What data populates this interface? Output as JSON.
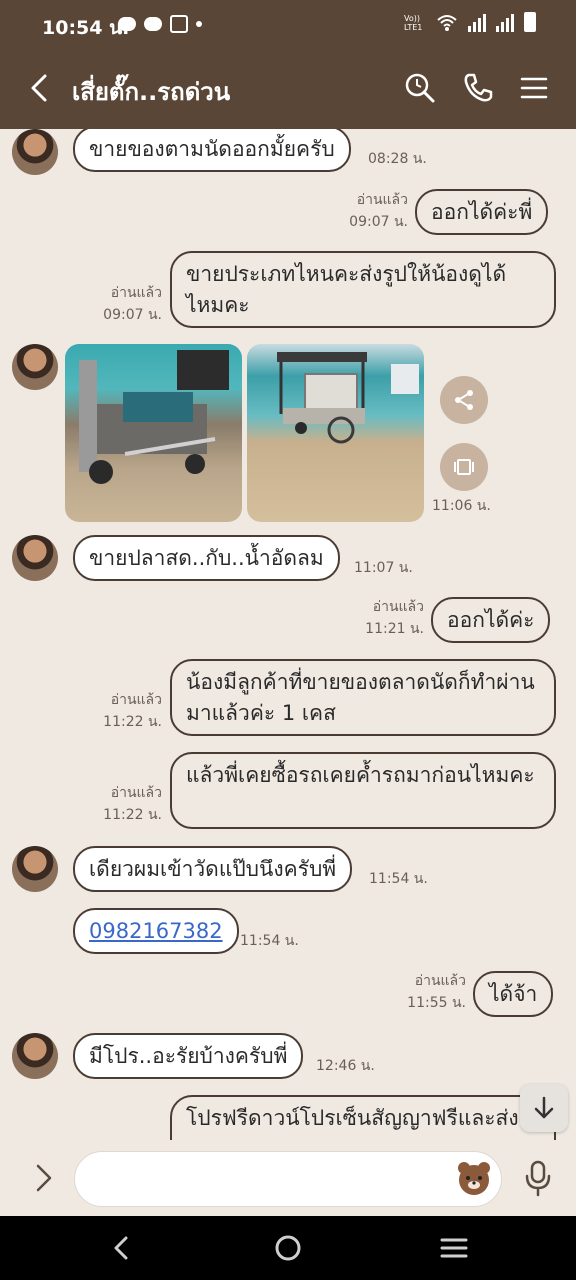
{
  "status_bar": {
    "time": "10:54 น.",
    "icons": [
      "line-icon",
      "line-icon",
      "seven-eleven-icon",
      "dot-icon",
      "volte-icon",
      "wifi-icon",
      "signal-icon",
      "signal-icon",
      "battery-icon"
    ]
  },
  "header": {
    "title": "เสี่ยตั๊ก..รถด่วน",
    "back_icon": "chevron-left-icon",
    "actions": [
      "search-icon",
      "phone-icon",
      "menu-icon"
    ]
  },
  "messages": [
    {
      "side": "them",
      "text": "ขายของตามนัดออกมั้ยครับ",
      "time": "08:28 น."
    },
    {
      "side": "me",
      "text": "ออกได้ค่ะพี่",
      "read": "อ่านแล้ว",
      "time": "09:07 น."
    },
    {
      "side": "me",
      "text": "ขายประเภทไหนคะส่งรูปให้น้องดูได้ไหมคะ",
      "read": "อ่านแล้ว",
      "time": "09:07 น."
    },
    {
      "side": "them",
      "type": "photos",
      "count": 2,
      "time": "11:06 น."
    },
    {
      "side": "them",
      "text": "ขายปลาสด..กับ..น้ำอัดลม",
      "time": "11:07 น."
    },
    {
      "side": "me",
      "text": "ออกได้ค่ะ",
      "read": "อ่านแล้ว",
      "time": "11:21 น."
    },
    {
      "side": "me",
      "text": "น้องมีลูกค้าที่ขายของตลาดนัดก็ทำผ่านมาแล้วค่ะ 1 เคส",
      "read": "อ่านแล้ว",
      "time": "11:22 น."
    },
    {
      "side": "me",
      "text": "แล้วพี่เคยซื้อรถเคยค้ำรถมาก่อนไหมคะ",
      "read": "อ่านแล้ว",
      "time": "11:22 น."
    },
    {
      "side": "them",
      "text": "เดียวผมเข้าวัดแป๊บนึงครับพี่",
      "time": "11:54 น."
    },
    {
      "side": "them",
      "text": "0982167382",
      "link": true,
      "time": "11:54 น."
    },
    {
      "side": "me",
      "text": "ได้จ้า",
      "read": "อ่านแล้ว",
      "time": "11:55 น."
    },
    {
      "side": "them",
      "text": "มีโปร..อะรัยบ้างครับพี่",
      "time": "12:46 น."
    },
    {
      "side": "me",
      "text": "โปรฟรีดาวน์โปรเซ็นสัญญาฟรีและส่ง",
      "partial": true
    }
  ],
  "photo_actions": [
    "share-icon",
    "gallery-icon"
  ],
  "input": {
    "placeholder": "",
    "expand_icon": "chevron-right-icon",
    "sticker_icon": "bear-sticker-icon",
    "mic_icon": "microphone-icon"
  },
  "scroll_icon": "arrow-down-icon",
  "nav": [
    "back-icon",
    "home-icon",
    "recents-icon"
  ],
  "colors": {
    "header": "#5a4636",
    "background": "#efe9e2",
    "bubble_them": "#ffffff",
    "bubble_me": "#efe9e2",
    "bubble_border": "#4a3c33",
    "link": "#3a68c9",
    "photo_action_bg": "#c8b2a0"
  }
}
